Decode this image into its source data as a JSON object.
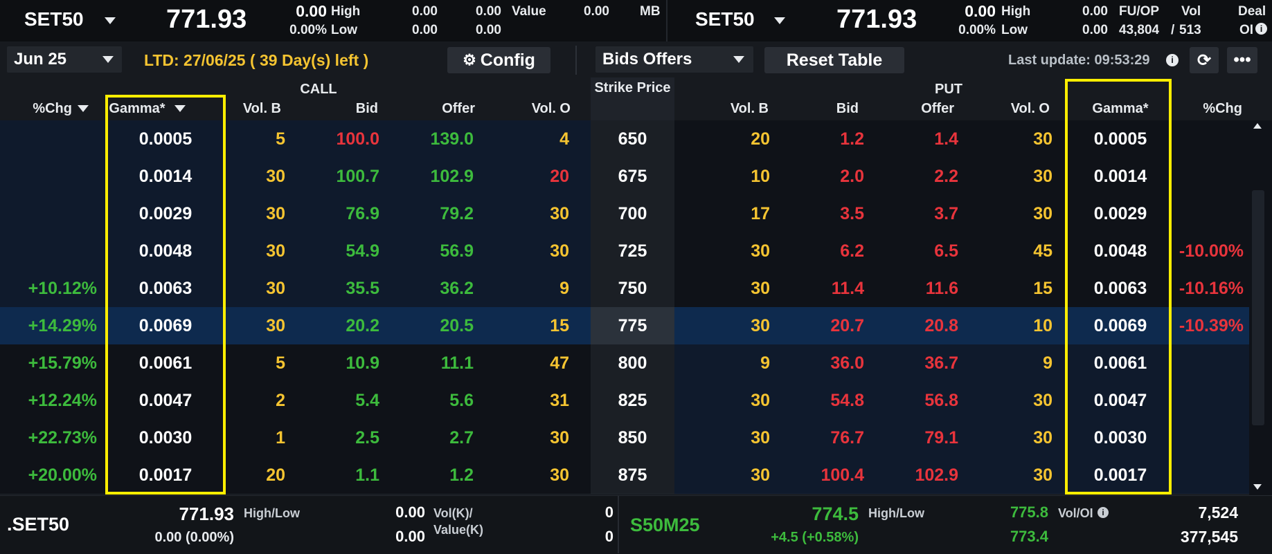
{
  "ticker": {
    "left": {
      "symbol": "SET50",
      "price": "771.93",
      "change": "0.00",
      "change_pct": "0.00%",
      "high_label": "High",
      "low_label": "Low",
      "high": "0.00",
      "low": "0.00",
      "high2": "0.00",
      "low2": "0.00",
      "value_label": "Value",
      "value": "0.00",
      "value_unit": "MB"
    },
    "right": {
      "symbol": "SET50",
      "price": "771.93",
      "change": "0.00",
      "change_pct": "0.00%",
      "high_label": "High",
      "low_label": "Low",
      "high": "0.00",
      "low": "0.00",
      "fuop_label": "FU/OP",
      "vol_label": "Vol",
      "fu_vol": "43,804",
      "slash": "/",
      "op_vol": "513",
      "deal_label": "Deal",
      "oi_label": "OI"
    }
  },
  "controls": {
    "series": "Jun 25",
    "ltd": "LTD: 27/06/25 ( 39 Day(s) left )",
    "config": "Config",
    "view": "Bids Offers",
    "reset": "Reset Table",
    "last_update": "Last update: 09:53:29"
  },
  "headers": {
    "call": "CALL",
    "put": "PUT",
    "strike": "Strike Price",
    "chg": "%Chg",
    "gamma": "Gamma*",
    "volb": "Vol. B",
    "bid": "Bid",
    "offer": "Offer",
    "volo": "Vol. O"
  },
  "rows": [
    {
      "call_chg": "",
      "call_gamma": "0.0005",
      "call_volb": "5",
      "call_bid": "100.0",
      "call_offer": "139.0",
      "call_volo": "4",
      "strike": "650",
      "put_volb": "20",
      "put_bid": "1.2",
      "put_offer": "1.4",
      "put_volo": "30",
      "put_gamma": "0.0005",
      "put_chg": ""
    },
    {
      "call_chg": "",
      "call_gamma": "0.0014",
      "call_volb": "30",
      "call_bid": "100.7",
      "call_offer": "102.9",
      "call_volo": "20",
      "strike": "675",
      "put_volb": "10",
      "put_bid": "2.0",
      "put_offer": "2.2",
      "put_volo": "30",
      "put_gamma": "0.0014",
      "put_chg": ""
    },
    {
      "call_chg": "",
      "call_gamma": "0.0029",
      "call_volb": "30",
      "call_bid": "76.9",
      "call_offer": "79.2",
      "call_volo": "30",
      "strike": "700",
      "put_volb": "17",
      "put_bid": "3.5",
      "put_offer": "3.7",
      "put_volo": "30",
      "put_gamma": "0.0029",
      "put_chg": ""
    },
    {
      "call_chg": "",
      "call_gamma": "0.0048",
      "call_volb": "30",
      "call_bid": "54.9",
      "call_offer": "56.9",
      "call_volo": "30",
      "strike": "725",
      "put_volb": "30",
      "put_bid": "6.2",
      "put_offer": "6.5",
      "put_volo": "45",
      "put_gamma": "0.0048",
      "put_chg": "-10.00%"
    },
    {
      "call_chg": "+10.12%",
      "call_gamma": "0.0063",
      "call_volb": "30",
      "call_bid": "35.5",
      "call_offer": "36.2",
      "call_volo": "9",
      "strike": "750",
      "put_volb": "30",
      "put_bid": "11.4",
      "put_offer": "11.6",
      "put_volo": "15",
      "put_gamma": "0.0063",
      "put_chg": "-10.16%"
    },
    {
      "call_chg": "+14.29%",
      "call_gamma": "0.0069",
      "call_volb": "30",
      "call_bid": "20.2",
      "call_offer": "20.5",
      "call_volo": "15",
      "strike": "775",
      "put_volb": "30",
      "put_bid": "20.7",
      "put_offer": "20.8",
      "put_volo": "10",
      "put_gamma": "0.0069",
      "put_chg": "-10.39%"
    },
    {
      "call_chg": "+15.79%",
      "call_gamma": "0.0061",
      "call_volb": "5",
      "call_bid": "10.9",
      "call_offer": "11.1",
      "call_volo": "47",
      "strike": "800",
      "put_volb": "9",
      "put_bid": "36.0",
      "put_offer": "36.7",
      "put_volo": "9",
      "put_gamma": "0.0061",
      "put_chg": ""
    },
    {
      "call_chg": "+12.24%",
      "call_gamma": "0.0047",
      "call_volb": "2",
      "call_bid": "5.4",
      "call_offer": "5.6",
      "call_volo": "31",
      "strike": "825",
      "put_volb": "30",
      "put_bid": "54.8",
      "put_offer": "56.8",
      "put_volo": "30",
      "put_gamma": "0.0047",
      "put_chg": ""
    },
    {
      "call_chg": "+22.73%",
      "call_gamma": "0.0030",
      "call_volb": "1",
      "call_bid": "2.5",
      "call_offer": "2.7",
      "call_volo": "30",
      "strike": "850",
      "put_volb": "30",
      "put_bid": "76.7",
      "put_offer": "79.1",
      "put_volo": "30",
      "put_gamma": "0.0030",
      "put_chg": ""
    },
    {
      "call_chg": "+20.00%",
      "call_gamma": "0.0017",
      "call_volb": "20",
      "call_bid": "1.1",
      "call_offer": "1.2",
      "call_volo": "30",
      "strike": "875",
      "put_volb": "30",
      "put_bid": "100.4",
      "put_offer": "102.9",
      "put_volo": "30",
      "put_gamma": "0.0017",
      "put_chg": ""
    }
  ],
  "row_style": {
    "call_bid_colors": [
      "#e8343c",
      "#3dbb3d",
      "#3dbb3d",
      "#3dbb3d",
      "#3dbb3d",
      "#3dbb3d",
      "#3dbb3d",
      "#3dbb3d",
      "#3dbb3d",
      "#3dbb3d"
    ],
    "call_volo_colors": [
      "#f5c431",
      "#e8343c",
      "#f5c431",
      "#f5c431",
      "#f5c431",
      "#f5c431",
      "#f5c431",
      "#f5c431",
      "#f5c431",
      "#f5c431"
    ]
  },
  "footer": {
    "index_symbol": ".SET50",
    "index_price": "771.93",
    "index_change": "0.00 (0.00%)",
    "hl_label": "High/Low",
    "high": "0.00",
    "low": "0.00",
    "volk_label": "Vol(K)/",
    "value_label": "Value(K)",
    "vol": "0",
    "value": "0",
    "fut_symbol": "S50M25",
    "fut_price": "774.5",
    "fut_change": "+4.5 (+0.58%)",
    "fut_hl_label": "High/Low",
    "fut_high": "775.8",
    "fut_low": "773.4",
    "voloi_label": "Vol/OI",
    "fut_vol": "7,524",
    "fut_oi": "377,545"
  },
  "colors": {
    "up": "#3dbb3d",
    "down": "#e8343c",
    "volume": "#f5c431",
    "highlight": "#ffee00",
    "link": "#3f8ff0"
  }
}
